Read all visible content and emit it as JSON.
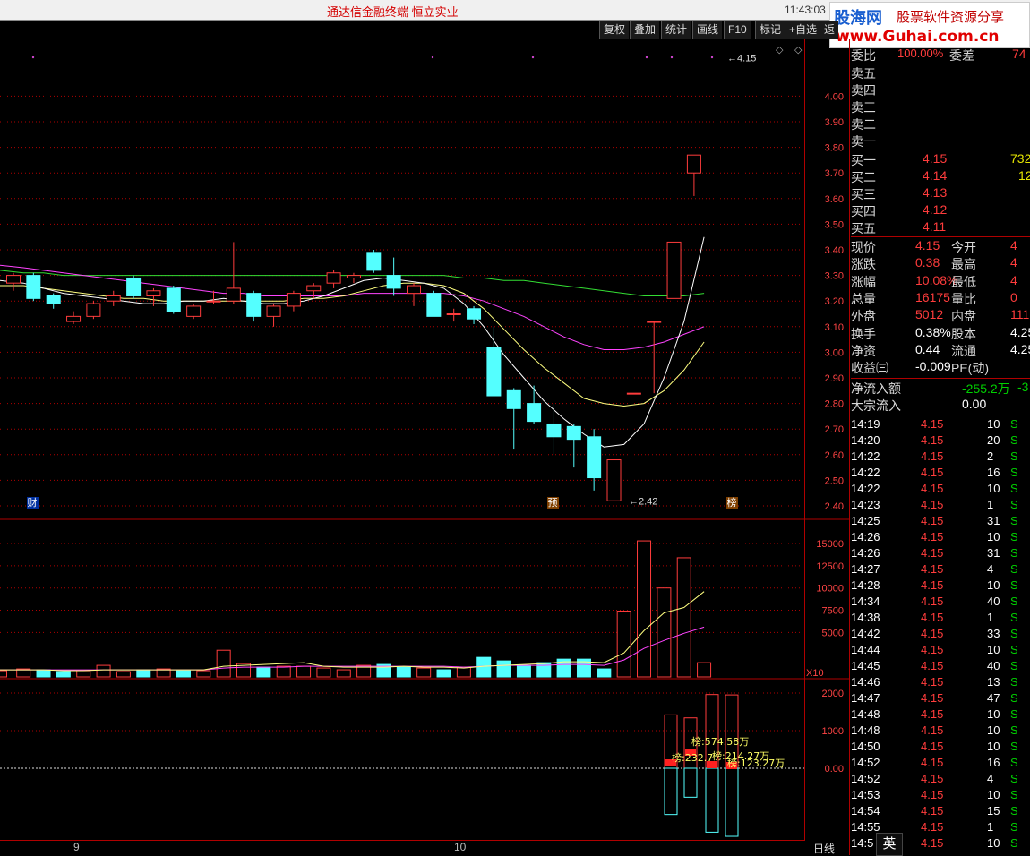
{
  "window": {
    "title": "通达信金融终端  恒立实业",
    "clock": "11:43:03"
  },
  "logo": {
    "name": "股海网",
    "slogan": "股票软件资源分享",
    "url": "www.Guhai.com.cn"
  },
  "toolbar": {
    "buttons": [
      "复权",
      "叠加",
      "统计",
      "画线",
      "F10",
      "标记",
      "+自选",
      "返"
    ]
  },
  "colors": {
    "up": "#ff3c3c",
    "down": "#54ffff",
    "ma5": "#ffffff",
    "ma10": "#ffff80",
    "ma20": "#ff44ff",
    "ma60": "#33dd33",
    "grid": "#b00000"
  },
  "markers": {
    "bottom": [
      "财",
      "预",
      "榜"
    ],
    "high_label": "4.15",
    "low_label": "2.42"
  },
  "order_book": {
    "header": {
      "label1": "委比",
      "value1": "100.00%",
      "label2": "委差",
      "value2": "74"
    },
    "sell": [
      {
        "label": "卖五"
      },
      {
        "label": "卖四"
      },
      {
        "label": "卖三"
      },
      {
        "label": "卖二"
      },
      {
        "label": "卖一"
      }
    ],
    "buy": [
      {
        "label": "买一",
        "price": "4.15",
        "vol": "732"
      },
      {
        "label": "买二",
        "price": "4.14",
        "vol": "12"
      },
      {
        "label": "买三",
        "price": "4.13",
        "vol": ""
      },
      {
        "label": "买四",
        "price": "4.12",
        "vol": ""
      },
      {
        "label": "买五",
        "price": "4.11",
        "vol": ""
      }
    ]
  },
  "quote": [
    {
      "l": "现价",
      "v": "4.15",
      "l2": "今开",
      "v2": "4"
    },
    {
      "l": "涨跌",
      "v": "0.38",
      "l2": "最高",
      "v2": "4"
    },
    {
      "l": "涨幅",
      "v": "10.08%",
      "l2": "最低",
      "v2": "4"
    },
    {
      "l": "总量",
      "v": "16175",
      "l2": "量比",
      "v2": "0"
    },
    {
      "l": "外盘",
      "v": "5012",
      "l2": "内盘",
      "v2": "111"
    },
    {
      "l": "换手",
      "v": "0.38%",
      "l2": "股本",
      "v2": "4.25"
    },
    {
      "l": "净资",
      "v": "0.44",
      "l2": "流通",
      "v2": "4.25"
    },
    {
      "l": "收益㈢",
      "v": "-0.009",
      "l2": "PE(动)",
      "v2": ""
    }
  ],
  "flow": [
    {
      "l": "净流入额",
      "v": "-255.2万",
      "v2": "-3"
    },
    {
      "l": "大宗流入",
      "v": "0.00",
      "v2": ""
    }
  ],
  "ticks": [
    [
      "14:19",
      "4.15",
      "10",
      "S"
    ],
    [
      "14:20",
      "4.15",
      "20",
      "S"
    ],
    [
      "14:22",
      "4.15",
      "2",
      "S"
    ],
    [
      "14:22",
      "4.15",
      "16",
      "S"
    ],
    [
      "14:22",
      "4.15",
      "10",
      "S"
    ],
    [
      "14:23",
      "4.15",
      "1",
      "S"
    ],
    [
      "14:25",
      "4.15",
      "31",
      "S"
    ],
    [
      "14:26",
      "4.15",
      "10",
      "S"
    ],
    [
      "14:26",
      "4.15",
      "31",
      "S"
    ],
    [
      "14:27",
      "4.15",
      "4",
      "S"
    ],
    [
      "14:28",
      "4.15",
      "10",
      "S"
    ],
    [
      "14:34",
      "4.15",
      "40",
      "S"
    ],
    [
      "14:38",
      "4.15",
      "1",
      "S"
    ],
    [
      "14:42",
      "4.15",
      "33",
      "S"
    ],
    [
      "14:44",
      "4.15",
      "10",
      "S"
    ],
    [
      "14:45",
      "4.15",
      "40",
      "S"
    ],
    [
      "14:46",
      "4.15",
      "13",
      "S"
    ],
    [
      "14:47",
      "4.15",
      "47",
      "S"
    ],
    [
      "14:48",
      "4.15",
      "10",
      "S"
    ],
    [
      "14:48",
      "4.15",
      "10",
      "S"
    ],
    [
      "14:50",
      "4.15",
      "10",
      "S"
    ],
    [
      "14:52",
      "4.15",
      "16",
      "S"
    ],
    [
      "14:52",
      "4.15",
      "4",
      "S"
    ],
    [
      "14:53",
      "4.15",
      "10",
      "S"
    ],
    [
      "14:54",
      "4.15",
      "15",
      "S"
    ],
    [
      "14:55",
      "4.15",
      "1",
      "S"
    ],
    [
      "14:5",
      "4.15",
      "10",
      "S"
    ]
  ],
  "bottom_axis": {
    "labels": [
      "9",
      "10"
    ],
    "period": "日线",
    "ime": "英"
  },
  "chart_data": [
    {
      "type": "candlestick",
      "price_axis": [
        2.4,
        2.5,
        2.6,
        2.7,
        2.8,
        2.9,
        3.0,
        3.1,
        3.2,
        3.3,
        3.4,
        3.5,
        3.6,
        3.7,
        3.8,
        3.9,
        4.0
      ],
      "ylim": [
        2.35,
        4.2
      ],
      "candles": [
        {
          "o": 3.27,
          "h": 3.31,
          "l": 3.24,
          "c": 3.3
        },
        {
          "o": 3.3,
          "h": 3.31,
          "l": 3.2,
          "c": 3.21
        },
        {
          "o": 3.22,
          "h": 3.23,
          "l": 3.17,
          "c": 3.19
        },
        {
          "o": 3.12,
          "h": 3.16,
          "l": 3.11,
          "c": 3.14
        },
        {
          "o": 3.14,
          "h": 3.2,
          "l": 3.13,
          "c": 3.19
        },
        {
          "o": 3.2,
          "h": 3.24,
          "l": 3.18,
          "c": 3.22
        },
        {
          "o": 3.29,
          "h": 3.3,
          "l": 3.21,
          "c": 3.22
        },
        {
          "o": 3.22,
          "h": 3.25,
          "l": 3.18,
          "c": 3.24
        },
        {
          "o": 3.25,
          "h": 3.26,
          "l": 3.15,
          "c": 3.16
        },
        {
          "o": 3.14,
          "h": 3.19,
          "l": 3.13,
          "c": 3.18
        },
        {
          "o": 3.2,
          "h": 3.24,
          "l": 3.19,
          "c": 3.2
        },
        {
          "o": 3.2,
          "h": 3.43,
          "l": 3.19,
          "c": 3.25
        },
        {
          "o": 3.23,
          "h": 3.24,
          "l": 3.12,
          "c": 3.14
        },
        {
          "o": 3.14,
          "h": 3.19,
          "l": 3.1,
          "c": 3.18
        },
        {
          "o": 3.18,
          "h": 3.24,
          "l": 3.16,
          "c": 3.23
        },
        {
          "o": 3.24,
          "h": 3.27,
          "l": 3.21,
          "c": 3.26
        },
        {
          "o": 3.27,
          "h": 3.32,
          "l": 3.25,
          "c": 3.31
        },
        {
          "o": 3.29,
          "h": 3.31,
          "l": 3.27,
          "c": 3.3
        },
        {
          "o": 3.39,
          "h": 3.4,
          "l": 3.31,
          "c": 3.32
        },
        {
          "o": 3.3,
          "h": 3.37,
          "l": 3.22,
          "c": 3.25
        },
        {
          "o": 3.23,
          "h": 3.27,
          "l": 3.18,
          "c": 3.26
        },
        {
          "o": 3.23,
          "h": 3.24,
          "l": 3.15,
          "c": 3.14
        },
        {
          "o": 3.15,
          "h": 3.17,
          "l": 3.12,
          "c": 3.15
        },
        {
          "o": 3.17,
          "h": 3.18,
          "l": 3.11,
          "c": 3.13
        },
        {
          "o": 3.02,
          "h": 3.1,
          "l": 2.88,
          "c": 2.83
        },
        {
          "o": 2.85,
          "h": 2.86,
          "l": 2.62,
          "c": 2.78
        },
        {
          "o": 2.8,
          "h": 2.87,
          "l": 2.72,
          "c": 2.73
        },
        {
          "o": 2.72,
          "h": 2.8,
          "l": 2.6,
          "c": 2.67
        },
        {
          "o": 2.71,
          "h": 2.72,
          "l": 2.55,
          "c": 2.66
        },
        {
          "o": 2.67,
          "h": 2.7,
          "l": 2.46,
          "c": 2.51
        },
        {
          "o": 2.42,
          "h": 2.59,
          "l": 2.42,
          "c": 2.58
        },
        {
          "o": 2.84,
          "h": 2.84,
          "l": 2.84,
          "c": 2.84
        },
        {
          "o": 3.12,
          "h": 3.12,
          "l": 2.84,
          "c": 3.12
        },
        {
          "o": 3.21,
          "h": 3.43,
          "l": 3.21,
          "c": 3.43
        },
        {
          "o": 3.7,
          "h": 3.77,
          "l": 3.61,
          "c": 3.77
        }
      ],
      "ma5": [
        3.28,
        3.27,
        3.25,
        3.23,
        3.22,
        3.21,
        3.2,
        3.19,
        3.19,
        3.2,
        3.2,
        3.21,
        3.2,
        3.19,
        3.19,
        3.2,
        3.22,
        3.25,
        3.28,
        3.29,
        3.28,
        3.27,
        3.25,
        3.19,
        3.1,
        2.99,
        2.9,
        2.81,
        2.74,
        2.68,
        2.63,
        2.64,
        2.72,
        2.9,
        3.12,
        3.45
      ],
      "ma10": [
        3.26,
        3.26,
        3.25,
        3.24,
        3.23,
        3.22,
        3.21,
        3.21,
        3.2,
        3.2,
        3.2,
        3.2,
        3.2,
        3.2,
        3.2,
        3.21,
        3.21,
        3.22,
        3.24,
        3.26,
        3.27,
        3.27,
        3.26,
        3.23,
        3.17,
        3.09,
        3.01,
        2.94,
        2.88,
        2.82,
        2.8,
        2.79,
        2.8,
        2.85,
        2.93,
        3.04
      ],
      "ma20": [
        3.34,
        3.33,
        3.32,
        3.31,
        3.3,
        3.29,
        3.28,
        3.27,
        3.26,
        3.25,
        3.24,
        3.23,
        3.23,
        3.22,
        3.22,
        3.22,
        3.22,
        3.22,
        3.23,
        3.23,
        3.23,
        3.23,
        3.23,
        3.22,
        3.2,
        3.17,
        3.14,
        3.1,
        3.06,
        3.03,
        3.01,
        3.01,
        3.02,
        3.04,
        3.07,
        3.1
      ],
      "ma60": [
        3.32,
        3.31,
        3.31,
        3.3,
        3.3,
        3.3,
        3.3,
        3.3,
        3.3,
        3.3,
        3.3,
        3.3,
        3.3,
        3.3,
        3.3,
        3.3,
        3.3,
        3.3,
        3.3,
        3.3,
        3.3,
        3.3,
        3.3,
        3.29,
        3.29,
        3.28,
        3.28,
        3.27,
        3.26,
        3.25,
        3.24,
        3.23,
        3.22,
        3.22,
        3.22,
        3.23
      ]
    },
    {
      "type": "bar",
      "name": "volume",
      "axis": [
        5000,
        7500,
        10000,
        12500,
        15000
      ],
      "unit_label": "X10",
      "ylim": [
        0,
        16000
      ],
      "values": [
        700,
        900,
        800,
        600,
        700,
        1300,
        600,
        800,
        900,
        700,
        700,
        3000,
        1500,
        1100,
        1200,
        1200,
        1000,
        800,
        1300,
        1400,
        1100,
        1000,
        800,
        1100,
        2200,
        1800,
        1300,
        1600,
        2000,
        2000,
        900,
        7400,
        15300,
        10000,
        13400,
        1600
      ],
      "ma5": [
        800,
        800,
        800,
        700,
        700,
        800,
        800,
        800,
        800,
        800,
        800,
        1200,
        1300,
        1400,
        1500,
        1600,
        1200,
        1100,
        1100,
        1100,
        1200,
        1100,
        1100,
        1000,
        1200,
        1300,
        1400,
        1500,
        1700,
        1700,
        1600,
        2700,
        5200,
        7200,
        7800,
        9600
      ],
      "ma10": [
        800,
        800,
        800,
        800,
        800,
        800,
        800,
        800,
        800,
        800,
        800,
        1000,
        1100,
        1100,
        1100,
        1200,
        1200,
        1200,
        1200,
        1200,
        1200,
        1200,
        1200,
        1100,
        1200,
        1300,
        1300,
        1300,
        1400,
        1400,
        1300,
        1900,
        3200,
        4100,
        4900,
        5600
      ]
    },
    {
      "type": "bar",
      "name": "flow",
      "axis": [
        0.0,
        1000,
        2000
      ],
      "ylim": [
        -1900,
        2350
      ],
      "pos_values": [
        1420,
        1340,
        1960,
        1950
      ],
      "neg_values": [
        -1230,
        -770,
        -1700,
        -1810
      ],
      "labels": [
        "榜:574.58万",
        "榜:232.7",
        "榜:214.27万",
        "榜:123.27万"
      ]
    }
  ]
}
